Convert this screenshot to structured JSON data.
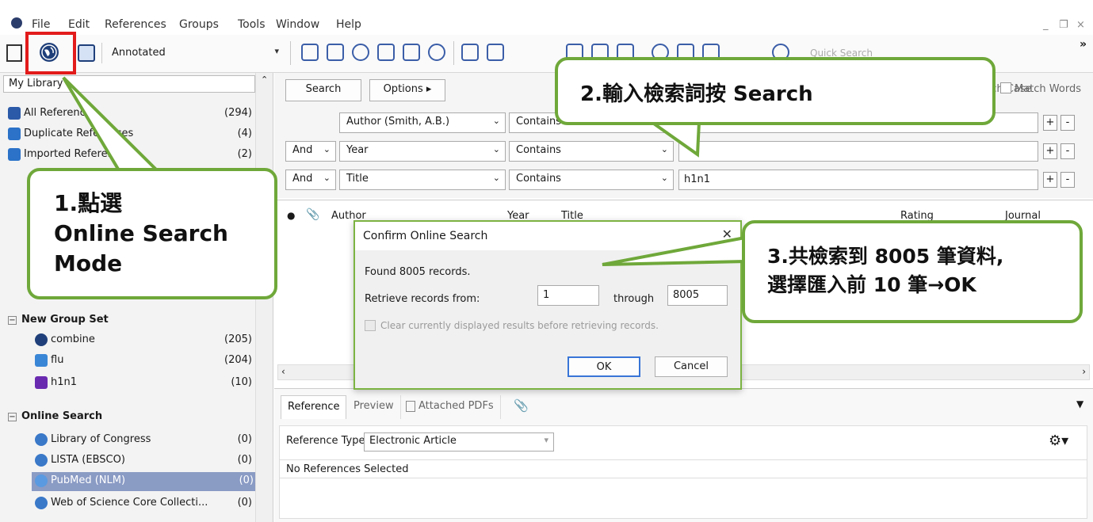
{
  "menu": {
    "items": [
      "File",
      "Edit",
      "References",
      "Groups",
      "Tools",
      "Window",
      "Help"
    ],
    "window_controls": [
      "_",
      "❐",
      "×"
    ]
  },
  "toolbar": {
    "mode_label": "Annotated",
    "quick_search_placeholder": "Quick Search",
    "overflow": "»"
  },
  "sidebar": {
    "library_header": "My Library",
    "items": [
      {
        "label": "All References",
        "count": "(294)"
      },
      {
        "label": "Duplicate References",
        "count": "(4)"
      },
      {
        "label": "Imported References",
        "count": "(2)"
      }
    ],
    "group_set": {
      "title": "New Group Set",
      "groups": [
        {
          "label": "combine",
          "count": "(205)"
        },
        {
          "label": "flu",
          "count": "(204)"
        },
        {
          "label": "h1n1",
          "count": "(10)"
        }
      ]
    },
    "online": {
      "title": "Online Search",
      "items": [
        {
          "label": "Library of Congress",
          "count": "(0)"
        },
        {
          "label": "LISTA (EBSCO)",
          "count": "(0)"
        },
        {
          "label": "PubMed (NLM)",
          "count": "(0)"
        },
        {
          "label": "Web of Science Core Collecti...",
          "count": "(0)"
        }
      ]
    }
  },
  "search": {
    "search_button": "Search",
    "options_button": "Options ▸",
    "match_case": "Match Case",
    "match_words": "Match Words",
    "rows": [
      {
        "bool": "",
        "field": "Author (Smith, A.B.)",
        "op": "Contains",
        "value": ""
      },
      {
        "bool": "And",
        "field": "Year",
        "op": "Contains",
        "value": ""
      },
      {
        "bool": "And",
        "field": "Title",
        "op": "Contains",
        "value": "h1n1"
      }
    ],
    "plus": "+",
    "minus": "-"
  },
  "results": {
    "columns": [
      "Author",
      "Year",
      "Title",
      "Rating",
      "Journal"
    ]
  },
  "bottom": {
    "tabs": [
      "Reference",
      "Preview",
      "Attached PDFs"
    ],
    "ref_type_label": "Reference Type:",
    "ref_type_value": "Electronic Article",
    "no_selection": "No References Selected"
  },
  "dialog": {
    "title": "Confirm Online Search",
    "found": "Found 8005 records.",
    "retrieve_label": "Retrieve records from:",
    "from_value": "1",
    "through_label": "through",
    "to_value": "8005",
    "clear_label": "Clear currently displayed results before retrieving records.",
    "ok": "OK",
    "cancel": "Cancel"
  },
  "callouts": {
    "step1_line1": "1.點選",
    "step1_line2": "Online Search",
    "step1_line3": "Mode",
    "step2": "2.輸入檢索詞按 Search",
    "step3_line1": "3.共檢索到 8005 筆資料,",
    "step3_line2": "選擇匯入前 10 筆→OK"
  },
  "colors": {
    "callout_border": "#6fa83a",
    "highlight_box": "#e21b1b",
    "selected_row": "#8a9bc4"
  }
}
